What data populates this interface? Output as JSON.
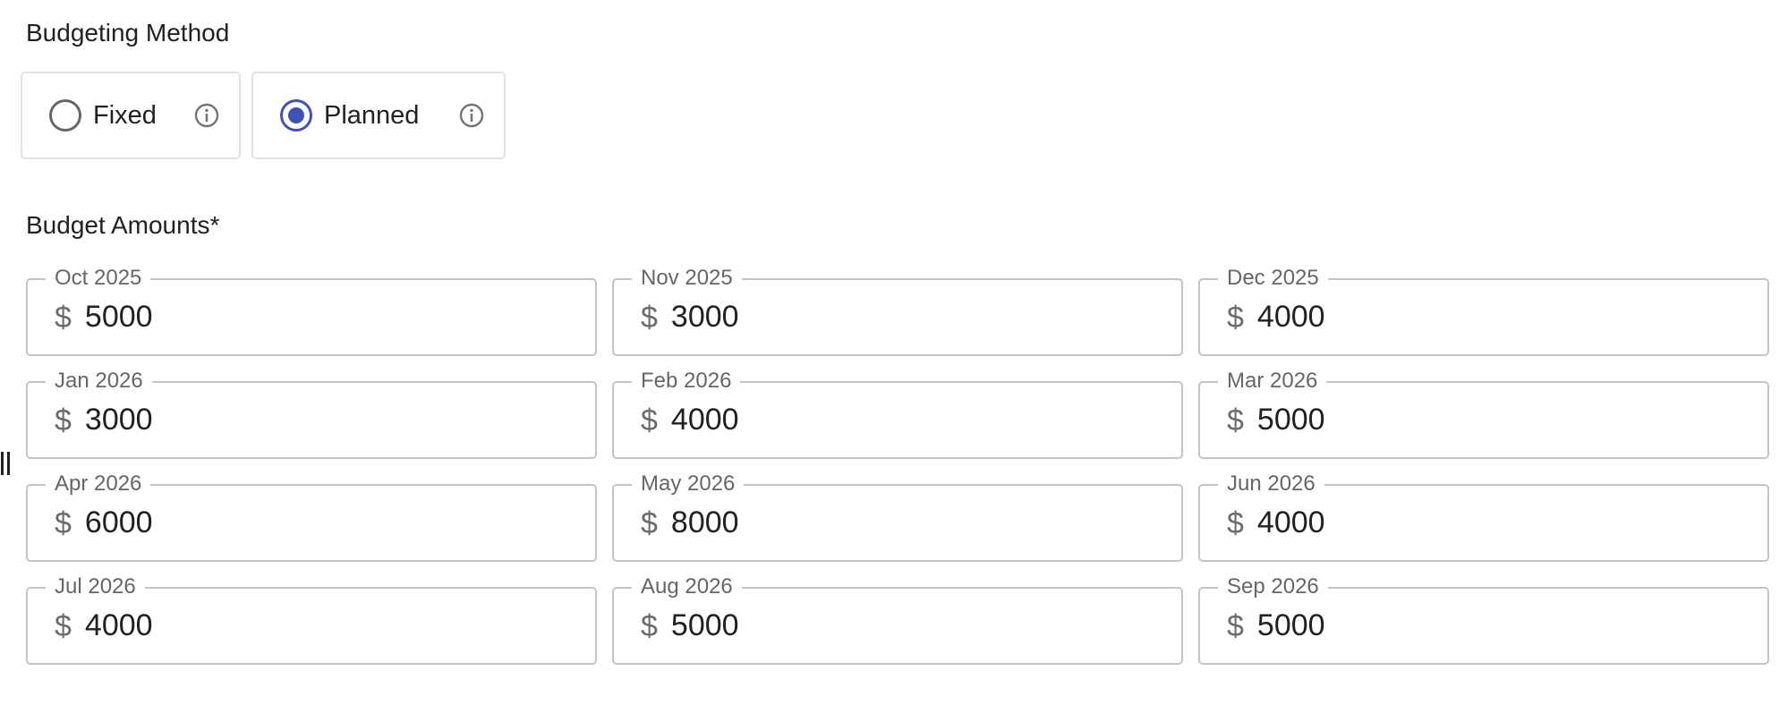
{
  "budgeting_method": {
    "title": "Budgeting Method",
    "options": [
      {
        "label": "Fixed",
        "selected": false
      },
      {
        "label": "Planned",
        "selected": true
      }
    ]
  },
  "budget_amounts": {
    "title": "Budget Amounts*",
    "currency_symbol": "$",
    "months": [
      {
        "label": "Oct 2025",
        "value": "5000"
      },
      {
        "label": "Nov 2025",
        "value": "3000"
      },
      {
        "label": "Dec 2025",
        "value": "4000"
      },
      {
        "label": "Jan 2026",
        "value": "3000"
      },
      {
        "label": "Feb 2026",
        "value": "4000"
      },
      {
        "label": "Mar 2026",
        "value": "5000"
      },
      {
        "label": "Apr 2026",
        "value": "6000"
      },
      {
        "label": "May 2026",
        "value": "8000"
      },
      {
        "label": "Jun 2026",
        "value": "4000"
      },
      {
        "label": "Jul 2026",
        "value": "4000"
      },
      {
        "label": "Aug 2026",
        "value": "5000"
      },
      {
        "label": "Sep 2026",
        "value": "5000"
      }
    ]
  },
  "colors": {
    "accent": "#3f51b5",
    "border": "#c4c4c4",
    "text": "#212121",
    "muted": "#666666"
  }
}
